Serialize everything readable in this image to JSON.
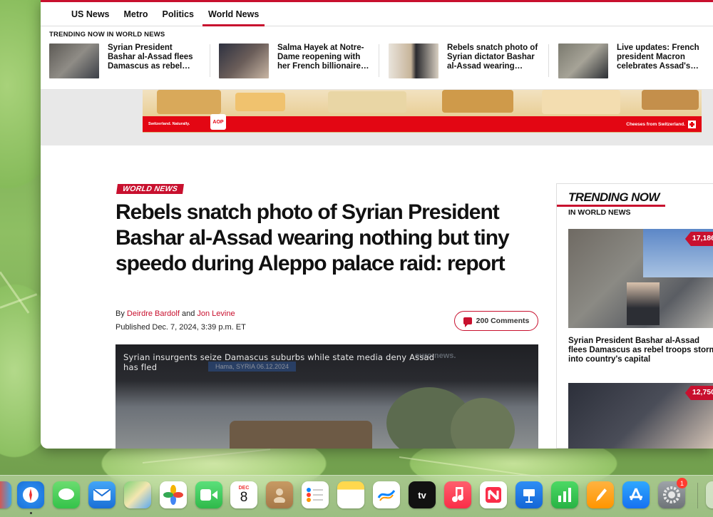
{
  "nav": {
    "items": [
      "US News",
      "Metro",
      "Politics",
      "World News"
    ],
    "active": "World News"
  },
  "trending_bar": {
    "label": "TRENDING NOW IN WORLD NEWS",
    "items": [
      {
        "text": "Syrian President Bashar al-Assad flees Damascus as rebel…"
      },
      {
        "text": "Salma Hayek at Notre-Dame reopening with her French billionaire…"
      },
      {
        "text": "Rebels snatch photo of Syrian dictator Bashar al-Assad wearing…"
      },
      {
        "text": "Live updates: French president Macron celebrates Assad's…"
      }
    ]
  },
  "ad": {
    "small_text": "Switzerland. Naturally.",
    "brand": "Cheeses from Switzerland.",
    "logo": "AOP"
  },
  "article": {
    "kicker": "WORLD NEWS",
    "headline": "Rebels snatch photo of Syrian President Bashar al-Assad wearing nothing but tiny speedo during Aleppo palace raid: report",
    "by": "By",
    "and": "and",
    "author1": "Deirdre Bardolf",
    "author2": "Jon Levine",
    "published": "Published Dec. 7, 2024, 3:39 p.m. ET",
    "comments": "200 Comments"
  },
  "video": {
    "caption": "Syrian insurgents seize Damascus suburbs while state media deny Assad has fled",
    "location": "Hama, SYRIA 06.12.2024",
    "logo": "euro news."
  },
  "sidebar": {
    "title": "TRENDING NOW",
    "subtitle": "IN WORLD NEWS",
    "items": [
      {
        "count": "17,186",
        "text": "Syrian President Bashar al-Assad flees Damascus as rebel troops storm into country's capital"
      },
      {
        "count": "12,750",
        "text": ""
      }
    ]
  },
  "dock": {
    "calendar_month": "DEC",
    "calendar_day": "8",
    "tv_label": "tv",
    "settings_badge": "1",
    "icons": [
      "finder-icon",
      "safari-icon",
      "messages-icon",
      "mail-icon",
      "maps-icon",
      "photos-icon",
      "facetime-icon",
      "calendar-icon",
      "contacts-icon",
      "reminders-icon",
      "notes-icon",
      "freeform-icon",
      "apple-tv-icon",
      "music-icon",
      "news-icon",
      "keynote-icon",
      "numbers-icon",
      "pages-icon",
      "app-store-icon",
      "system-settings-icon"
    ]
  },
  "colors": {
    "brand_red": "#c8102e",
    "link_red": "#c8102e"
  }
}
